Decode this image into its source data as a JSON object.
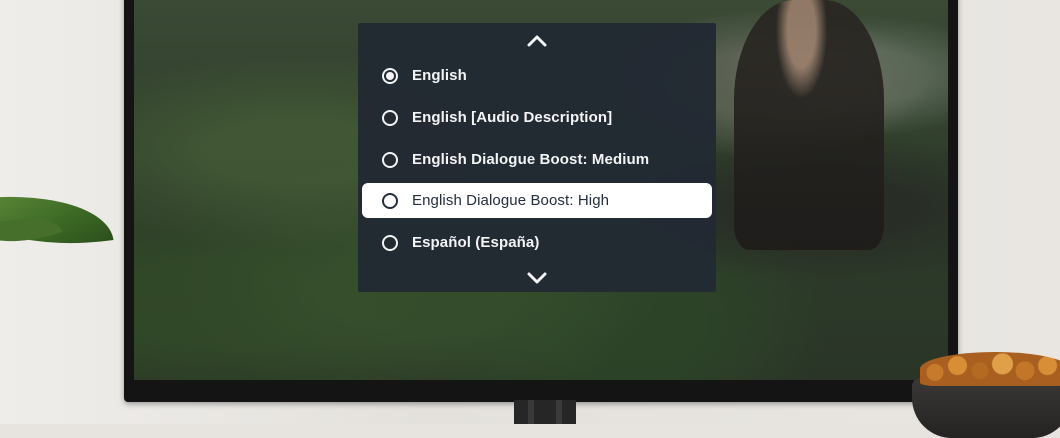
{
  "menu": {
    "scroll_up_icon": "chevron-up-icon",
    "scroll_down_icon": "chevron-down-icon",
    "items": [
      {
        "label": "English",
        "selected": true,
        "focused": false
      },
      {
        "label": "English [Audio Description]",
        "selected": false,
        "focused": false
      },
      {
        "label": "English Dialogue Boost: Medium",
        "selected": false,
        "focused": false
      },
      {
        "label": "English Dialogue Boost: High",
        "selected": false,
        "focused": true
      },
      {
        "label": "Español (España)",
        "selected": false,
        "focused": false
      }
    ]
  },
  "colors": {
    "menu_background": "#222933",
    "menu_text": "#f3f4f6",
    "focus_background": "#ffffff",
    "focus_text": "#232f3e"
  }
}
